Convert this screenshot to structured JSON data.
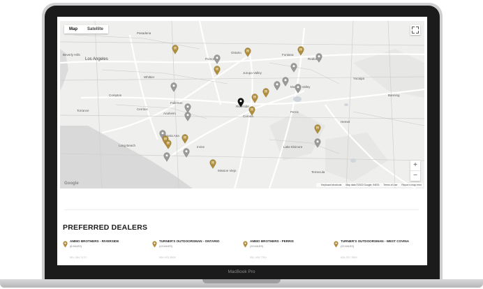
{
  "map": {
    "type_control": {
      "map_label": "Map",
      "satellite_label": "Satellite"
    },
    "cities": [
      "Pasadena",
      "Los Angeles",
      "Beverly Hills",
      "Ontario",
      "Fontana",
      "Redlands",
      "Pomona",
      "Whittier",
      "Torrance",
      "Anaheim",
      "Fullerton",
      "Corona",
      "Jurupa Valley",
      "Riverside",
      "Moreno Valley",
      "Perris",
      "Hemet",
      "Irvine",
      "Mission Viejo",
      "Temecula",
      "Lake Elsinore",
      "Santa Ana",
      "Long Beach",
      "Compton",
      "Cerritos",
      "Yucaipa",
      "Banning"
    ],
    "pin_colors": {
      "preferred": "#b08d3a",
      "other": "#9a9a9a",
      "current": "#111111"
    },
    "zoom": {
      "in": "+",
      "out": "−"
    },
    "google_logo": "Google",
    "footer": [
      "Keyboard shortcuts",
      "Map data ©2022 Google, INEGI",
      "Terms of Use",
      "Report a map error"
    ]
  },
  "dealers": {
    "title": "PREFERRED DEALERS",
    "items": [
      {
        "name": "AMMO BROTHERS - RIVERSIDE",
        "distance": "(6 MILES)",
        "phone": "951-384-7170"
      },
      {
        "name": "TURNER'S OUTDOORSMAN - ONTARIO",
        "distance": "(13 MILES)",
        "phone": "909-923-3009"
      },
      {
        "name": "AMMO BROTHERS - PERRIS",
        "distance": "(19 MILES)",
        "phone": "951-490-7700"
      },
      {
        "name": "TURNER'S OUTDOORSMAN - WEST COVINA",
        "distance": "(23 MILES)",
        "phone": "626-337-7845"
      }
    ]
  },
  "laptop": {
    "brand": "MacBook Pro"
  }
}
